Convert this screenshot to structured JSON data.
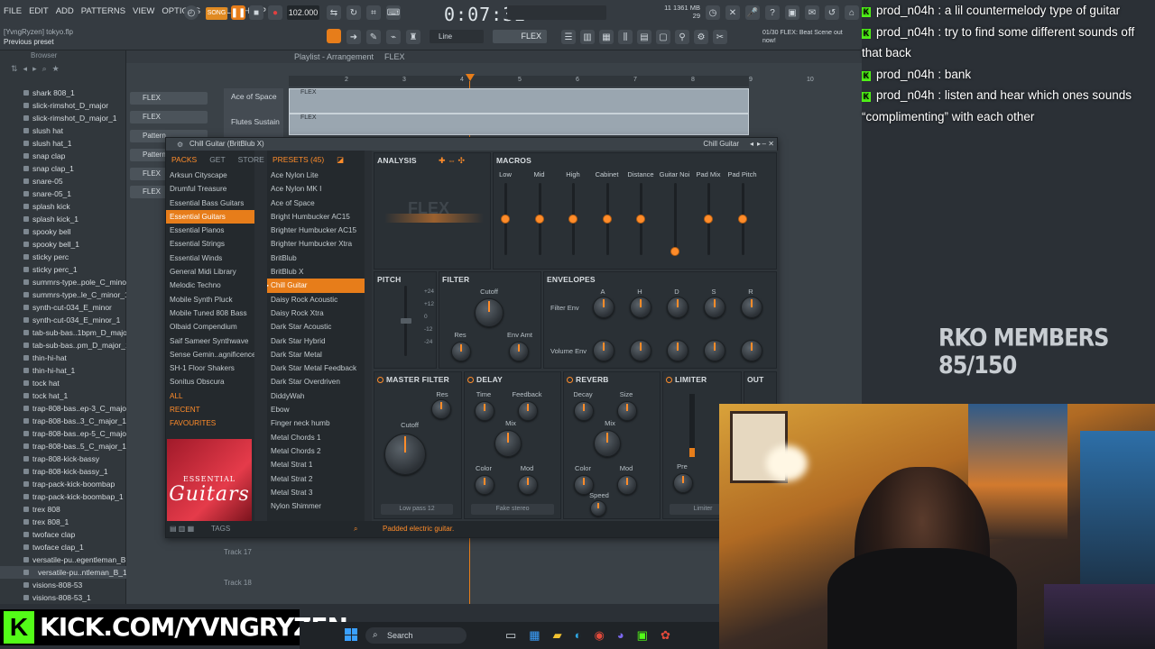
{
  "menu": [
    "FILE",
    "EDIT",
    "ADD",
    "PATTERNS",
    "VIEW",
    "OPTIONS",
    "TOOLS",
    "HELP"
  ],
  "song_info": {
    "user": "[YvngRyzen] tokyo.flp",
    "hint": "Previous preset"
  },
  "transport": {
    "mode": "SONG",
    "tempo": "102.000",
    "time": "0:07:32",
    "cpu": "11",
    "mem": "1361 MB",
    "poly": "29"
  },
  "pattern_selector": "FLEX",
  "snap": "Line",
  "news": "01/30 FLEX: Beat Scene out now!",
  "browser": {
    "title": "Browser",
    "items": [
      "shark 808_1",
      "slick-rimshot_D_major",
      "slick-rimshot_D_major_1",
      "slush hat",
      "slush hat_1",
      "snap clap",
      "snap clap_1",
      "snare-05",
      "snare-05_1",
      "splash kick",
      "splash kick_1",
      "spooky bell",
      "spooky bell_1",
      "sticky perc",
      "sticky perc_1",
      "summrs-type..pole_C_minor",
      "summrs-type..le_C_minor_1",
      "synth-cut-034_E_minor",
      "synth-cut-034_E_minor_1",
      "tab-sub-bas..1bpm_D_major",
      "tab-sub-bas..pm_D_major_1",
      "thin-hi-hat",
      "thin-hi-hat_1",
      "tock hat",
      "tock hat_1",
      "trap-808-bas..ep-3_C_major",
      "trap-808-bas..3_C_major_1",
      "trap-808-bas..ep-5_C_major",
      "trap-808-bas..5_C_major_1",
      "trap-808-kick-bassy",
      "trap-808-kick-bassy_1",
      "trap-pack-kick-boombap",
      "trap-pack-kick-boombap_1",
      "trex 808",
      "trex 808_1",
      "twoface clap",
      "twoface clap_1",
      "versatile-pu..egentleman_B",
      "versatile-pu..ntleman_B_1",
      "visions-808-53",
      "visions-808-53_1"
    ]
  },
  "playlist": {
    "title": "Playlist - Arrangement",
    "pattern": "FLEX",
    "patterns": [
      "FLEX",
      "FLEX",
      "Pattern",
      "Pattern",
      "FLEX",
      "FLEX"
    ],
    "tracks": [
      "Ace of Space",
      "Flutes Sustain"
    ],
    "bottom_tracks": [
      "Track 17",
      "Track 18"
    ],
    "ruler": [
      "2",
      "3",
      "4",
      "5",
      "6",
      "7",
      "8",
      "9",
      "10"
    ]
  },
  "flex": {
    "title": "Chill Guitar (BritBlub X)",
    "preset_name": "Chill Guitar",
    "tabs": {
      "packs": "PACKS",
      "get": "GET",
      "store": "STORE",
      "presets": "PRESETS (45)",
      "analysis": "ANALYSIS",
      "macros": "MACROS"
    },
    "packs": [
      "Arksun Cityscape",
      "Drumful Treasure",
      "Essential Bass Guitars",
      "Essential Guitars",
      "Essential Pianos",
      "Essential Strings",
      "Essential Winds",
      "General Midi Library",
      "Melodic Techno",
      "Mobile Synth Pluck",
      "Mobile Tuned 808 Bass",
      "Olbaid Compendium",
      "Saif Sameer Synthwave",
      "Sense Gemin..agnificence",
      "SH-1 Floor Shakers",
      "Sonitus Obscura",
      "ALL",
      "RECENT",
      "FAVOURITES"
    ],
    "active_pack_index": 3,
    "pack_art": {
      "top": "ESSENTIAL",
      "big": "Guitars"
    },
    "presets": [
      "Ace Nylon Lite",
      "Ace Nylon MK I",
      "Ace of Space",
      "Bright Humbucker AC15",
      "Brighter Humbucker AC15",
      "Brighter Humbucker Xtra",
      "BritBlub",
      "BritBlub X",
      "Chill Guitar",
      "Daisy Rock Acoustic",
      "Daisy Rock Xtra",
      "Dark Star Acoustic",
      "Dark Star Hybrid",
      "Dark Star Metal",
      "Dark Star Metal Feedback",
      "Dark Star Overdriven",
      "DiddyWah",
      "Ebow",
      "Finger neck humb",
      "Metal Chords 1",
      "Metal Chords 2",
      "Metal Strat 1",
      "Metal Strat 2",
      "Metal Strat 3",
      "Nylon Shimmer"
    ],
    "active_preset_index": 8,
    "macros": [
      {
        "label": "Low",
        "value": 0.5
      },
      {
        "label": "Mid",
        "value": 0.5
      },
      {
        "label": "High",
        "value": 0.5
      },
      {
        "label": "Cabinet",
        "value": 0.5
      },
      {
        "label": "Distance",
        "value": 0.5
      },
      {
        "label": "Guitar Noi",
        "value": 0.05
      },
      {
        "label": "Pad Mix",
        "value": 0.5
      },
      {
        "label": "Pad Pitch",
        "value": 0.5
      }
    ],
    "sections": {
      "pitch": "PITCH",
      "filter": "FILTER",
      "envelopes": "ENVELOPES",
      "master_filter": "MASTER FILTER",
      "delay": "DELAY",
      "reverb": "REVERB",
      "limiter": "LIMITER",
      "out": "OUT"
    },
    "filter_knobs": {
      "cutoff": "Cutoff",
      "res": "Res",
      "env_amt": "Env Amt"
    },
    "pitch_marks": [
      "+24",
      "+12",
      "0",
      "-12",
      "-24"
    ],
    "env_cols": [
      "A",
      "H",
      "D",
      "S",
      "R"
    ],
    "env_rows": [
      "Filter Env",
      "Volume Env"
    ],
    "master_filter": {
      "res": "Res",
      "cutoff": "Cutoff",
      "mode": "Low pass 12"
    },
    "delay": {
      "time": "Time",
      "feedback": "Feedback",
      "mix": "Mix",
      "color": "Color",
      "mod": "Mod",
      "mode": "Fake stereo"
    },
    "reverb": {
      "decay": "Decay",
      "size": "Size",
      "mix": "Mix",
      "color": "Color",
      "mod": "Mod",
      "speed": "Speed"
    },
    "limiter": {
      "pre": "Pre",
      "mode": "Limiter"
    },
    "footer": {
      "tags": "TAGS",
      "status": "Padded electric guitar."
    }
  },
  "chat": [
    {
      "user": "prod_n04h",
      "msg": "a lil countermelody type of guitar"
    },
    {
      "user": "prod_n04h",
      "msg": "try to find some different sounds off that back"
    },
    {
      "user": "prod_n04h",
      "msg": "bank"
    },
    {
      "user": "prod_n04h",
      "msg": "listen and hear which ones sounds “complimenting” with each other"
    }
  ],
  "members": "RKO MEMBERS 85/150",
  "kick_banner": "KICK.COM/YVNGRYZEN",
  "kick_logo": "K",
  "taskbar": {
    "search": "Search"
  },
  "colors": {
    "accent": "#e77d1a",
    "kick_green": "#53fc18"
  }
}
